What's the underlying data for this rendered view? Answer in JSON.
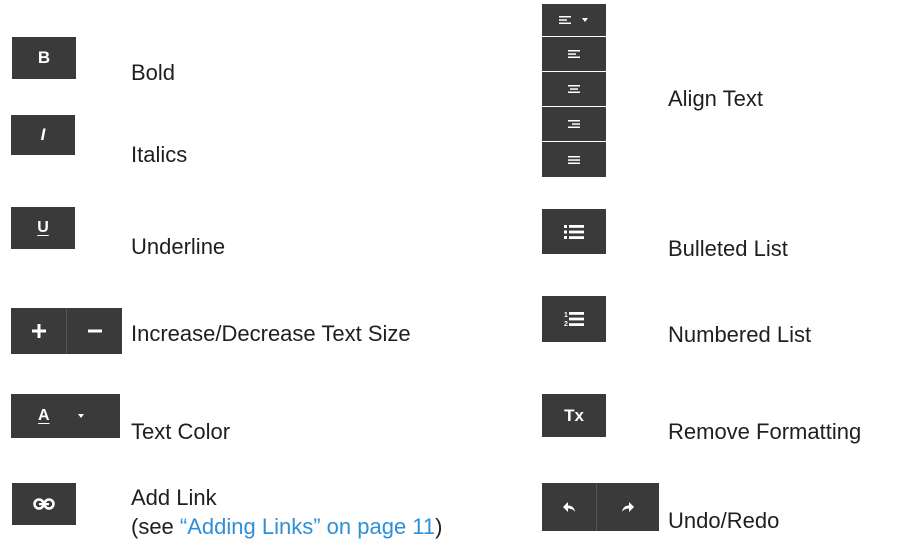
{
  "left": {
    "bold": {
      "icon_text": "B",
      "label": "Bold"
    },
    "italics": {
      "icon_text": "I",
      "label": "Italics"
    },
    "underline": {
      "icon_text": "U",
      "label": "Underline"
    },
    "text_size": {
      "label": "Increase/Decrease Text Size"
    },
    "text_color": {
      "icon_text": "A",
      "label": "Text Color"
    },
    "link": {
      "label": "Add Link",
      "see_prefix": "(see ",
      "see_link": "“Adding Links” on page 11",
      "see_suffix": ")"
    }
  },
  "right": {
    "align": {
      "label": "Align Text"
    },
    "bulleted": {
      "label": "Bulleted List"
    },
    "numbered": {
      "label": "Numbered List"
    },
    "remove_format": {
      "icon_text": "Tx",
      "label": "Remove Formatting"
    },
    "undo_redo": {
      "label": "Undo/Redo"
    }
  },
  "colors": {
    "button_bg": "#3a3a3a",
    "icon": "#ffffff",
    "link": "#2f8fd8",
    "text": "#1f1f1f"
  },
  "icons": [
    "bold-icon",
    "italic-icon",
    "underline-icon",
    "plus-icon",
    "minus-icon",
    "text-color-icon",
    "chevron-down-icon",
    "link-icon",
    "align-left-icon",
    "align-center-icon",
    "align-right-icon",
    "align-justify-icon",
    "bulleted-list-icon",
    "numbered-list-icon",
    "remove-format-icon",
    "undo-icon",
    "redo-icon"
  ]
}
